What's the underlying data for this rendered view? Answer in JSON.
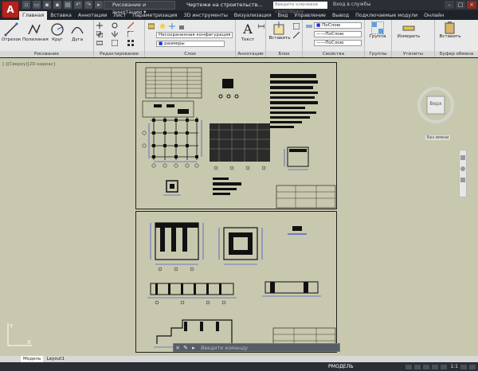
{
  "titlebar": {
    "app_logo": "A",
    "workspace": "Рисование и аннотации",
    "doc_title": "Чертежи на строительств...",
    "search_placeholder": "Введите ключевое слово/фразу",
    "login": "Вход в службы"
  },
  "tabs": [
    "Главная",
    "Вставка",
    "Аннотации",
    "Лист",
    "Параметризация",
    "3D инструменты",
    "Визуализация",
    "Вид",
    "Управление",
    "Вывод",
    "Подключаемые модули",
    "Онлайн"
  ],
  "ribbon": {
    "draw": {
      "title": "Рисование",
      "line": "Отрезок",
      "polyline": "Полилиния",
      "circle": "Круг",
      "arc": "Дуга"
    },
    "modify": {
      "title": "Редактирование"
    },
    "layers": {
      "title": "Слои",
      "layer_state": "Несохраненная конфигурация слое",
      "layer_name": "размеры"
    },
    "annotation": {
      "title": "Аннотации",
      "text": "Текст"
    },
    "block": {
      "title": "Блок",
      "insert": "Вставить"
    },
    "properties": {
      "title": "Свойства",
      "color": "ПоСлою",
      "linetype": "ПоСлою",
      "lineweight": "ПоСлою"
    },
    "groups": {
      "title": "Группы",
      "group": "Группа"
    },
    "utilities": {
      "title": "Утилиты",
      "measure": "Измерить"
    },
    "clipboard": {
      "title": "Буфер обмена",
      "paste": "Вставить"
    }
  },
  "viewport": {
    "label": "[-][Сверху][2D-каркас]",
    "viewcube_face": "Верх",
    "viewcube_compass": "Без имени"
  },
  "command": {
    "placeholder": "Введите команду"
  },
  "layout_tabs": [
    "Модель",
    "Layout1"
  ],
  "status": {
    "mode": "РМОДЕЛЬ",
    "scale": "1:1"
  },
  "colors": {
    "accent": "#b3221c",
    "background": "#c8c8ae",
    "dimension_blue": "#1a2fd6"
  }
}
